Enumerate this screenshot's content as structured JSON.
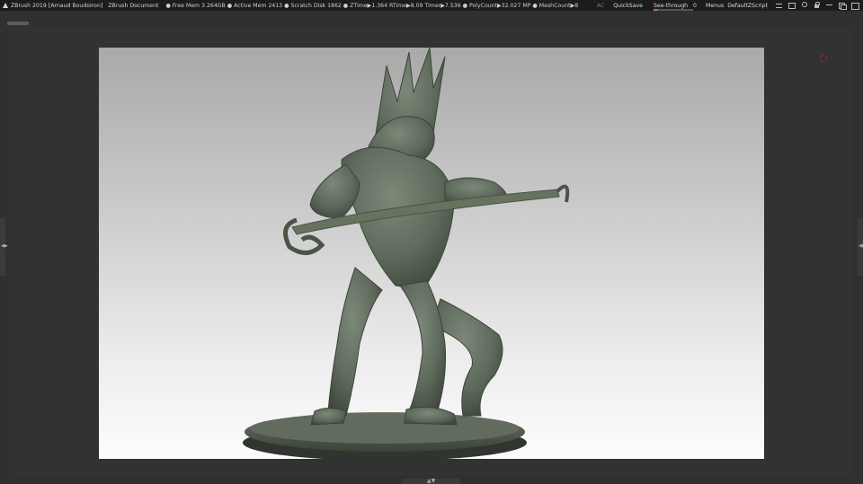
{
  "titlebar": {
    "app_title": "ZBrush 2019 [Arnaud Boudoiron]",
    "document": "ZBrush Document",
    "stats": "● Free Mem 3.264GB ● Active Mem 2413 ● Scratch Disk 1862 ● ZTime▶1.364 RTime▶8.09 Timer▶7.536 ● PolyCount▶32.027 MP ● MeshCount▶8",
    "ac_label": "AC",
    "quicksave_label": "QuickSave",
    "see_through_label": "See-through",
    "see_through_value": "0",
    "see_through_fraction": 0.12,
    "menus_label": "Menus",
    "default_script_label": "DefaultZScript"
  },
  "icons": [
    "zbrush-logo-icon",
    "layout-icon",
    "window-icon",
    "palette-icon",
    "minimize-icon",
    "restore-icon",
    "maximize-icon",
    "lock-icon"
  ],
  "colors": {
    "accent": "#e06a1c",
    "titlebar_bg": "#1c1c1c",
    "ui_bg": "#303030",
    "model": "#5f6a5c"
  },
  "handles": {
    "side_glyph": "◀▶",
    "bottom_glyph": "▲▼"
  }
}
